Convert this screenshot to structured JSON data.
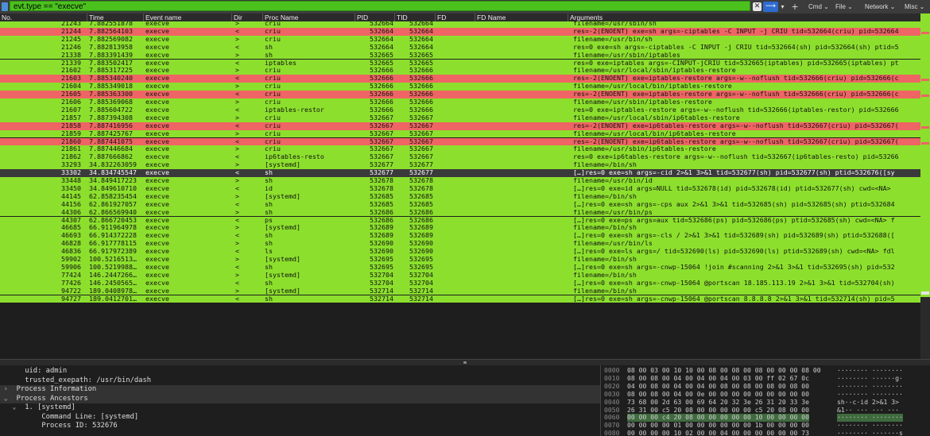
{
  "filter": {
    "value": "evt.type == \"execve\""
  },
  "toolbar": {
    "clear": "✕",
    "apply": "⟶",
    "dropdown": "▾",
    "add": "+"
  },
  "menus": [
    "Cmd ⌄",
    "File ⌄",
    "Network ⌄",
    "Misc ⌄"
  ],
  "columns": [
    "No.",
    "Time",
    "Event name",
    "Dir",
    "Proc Name",
    "PID",
    "TID",
    "FD",
    "FD Name",
    "Arguments"
  ],
  "rows": [
    {
      "no": "21243",
      "time": "7.882551878",
      "ev": "execve",
      "dir": ">",
      "proc": "criu",
      "pid": "532664",
      "tid": "532664",
      "args": "filename=/usr/sbin/sh",
      "c": "green"
    },
    {
      "no": "21244",
      "time": "7.882564103",
      "ev": "execve",
      "dir": "<",
      "proc": "criu",
      "pid": "532664",
      "tid": "532664",
      "args": "res=-2(ENOENT) exe=sh args=-ciptables -C INPUT -j CRIU tid=532664(criu) pid=532664",
      "c": "red"
    },
    {
      "no": "21245",
      "time": "7.882569082",
      "ev": "execve",
      "dir": ">",
      "proc": "criu",
      "pid": "532664",
      "tid": "532664",
      "args": "filename=/usr/bin/sh",
      "c": "green"
    },
    {
      "no": "21246",
      "time": "7.882813958",
      "ev": "execve",
      "dir": "<",
      "proc": "sh",
      "pid": "532664",
      "tid": "532664",
      "args": "res=0 exe=sh args=-ciptables -C INPUT -j CRIU tid=532664(sh) pid=532664(sh) ptid=5",
      "c": "green"
    },
    {
      "no": "21338",
      "time": "7.883391439",
      "ev": "execve",
      "dir": ">",
      "proc": "sh",
      "pid": "532665",
      "tid": "532665",
      "args": "filename=/usr/sbin/iptables",
      "c": "green"
    },
    {
      "no": "21339",
      "time": "7.883502417",
      "ev": "execve",
      "dir": "<",
      "proc": "iptables",
      "pid": "532665",
      "tid": "532665",
      "args": "res=0 exe=iptables args=-CINPUT-jCRIU tid=532665(iptables) pid=532665(iptables) pt",
      "c": "green"
    },
    {
      "no": "21602",
      "time": "7.885317225",
      "ev": "execve",
      "dir": ">",
      "proc": "criu",
      "pid": "532666",
      "tid": "532666",
      "args": "filename=/usr/local/sbin/iptables-restore",
      "c": "green"
    },
    {
      "no": "21603",
      "time": "7.885340240",
      "ev": "execve",
      "dir": "<",
      "proc": "criu",
      "pid": "532666",
      "tid": "532666",
      "args": "res=-2(ENOENT) exe=iptables-restore args=-w--noflush tid=532666(criu) pid=532666(c",
      "c": "red"
    },
    {
      "no": "21604",
      "time": "7.885349018",
      "ev": "execve",
      "dir": ">",
      "proc": "criu",
      "pid": "532666",
      "tid": "532666",
      "args": "filename=/usr/local/bin/iptables-restore",
      "c": "green"
    },
    {
      "no": "21605",
      "time": "7.885363300",
      "ev": "execve",
      "dir": "<",
      "proc": "criu",
      "pid": "532666",
      "tid": "532666",
      "args": "res=-2(ENOENT) exe=iptables-restore args=-w--noflush tid=532666(criu) pid=532666(c",
      "c": "red"
    },
    {
      "no": "21606",
      "time": "7.885369068",
      "ev": "execve",
      "dir": ">",
      "proc": "criu",
      "pid": "532666",
      "tid": "532666",
      "args": "filename=/usr/sbin/iptables-restore",
      "c": "green"
    },
    {
      "no": "21607",
      "time": "7.885604722",
      "ev": "execve",
      "dir": "<",
      "proc": "iptables-restor",
      "pid": "532666",
      "tid": "532666",
      "args": "res=0 exe=iptables-restore args=-w--noflush tid=532666(iptables-restor) pid=532666",
      "c": "green"
    },
    {
      "no": "21857",
      "time": "7.887394308",
      "ev": "execve",
      "dir": ">",
      "proc": "criu",
      "pid": "532667",
      "tid": "532667",
      "args": "filename=/usr/local/sbin/ip6tables-restore",
      "c": "green"
    },
    {
      "no": "21858",
      "time": "7.887416956",
      "ev": "execve",
      "dir": "<",
      "proc": "criu",
      "pid": "532667",
      "tid": "532667",
      "args": "res=-2(ENOENT) exe=ip6tables-restore args=-w--noflush tid=532667(criu) pid=532667(",
      "c": "red"
    },
    {
      "no": "21859",
      "time": "7.887425767",
      "ev": "execve",
      "dir": ">",
      "proc": "criu",
      "pid": "532667",
      "tid": "532667",
      "args": "filename=/usr/local/bin/ip6tables-restore",
      "c": "green"
    },
    {
      "no": "21860",
      "time": "7.887441075",
      "ev": "execve",
      "dir": "<",
      "proc": "criu",
      "pid": "532667",
      "tid": "532667",
      "args": "res=-2(ENOENT) exe=ip6tables-restore args=-w--noflush tid=532667(criu) pid=532667(",
      "c": "red"
    },
    {
      "no": "21861",
      "time": "7.887446684",
      "ev": "execve",
      "dir": ">",
      "proc": "criu",
      "pid": "532667",
      "tid": "532667",
      "args": "filename=/usr/sbin/ip6tables-restore",
      "c": "green"
    },
    {
      "no": "21862",
      "time": "7.887666862",
      "ev": "execve",
      "dir": "<",
      "proc": "ip6tables-resto",
      "pid": "532667",
      "tid": "532667",
      "args": "res=0 exe=ip6tables-restore args=-w--noflush tid=532667(ip6tables-resto) pid=53266",
      "c": "green"
    },
    {
      "no": "33293",
      "time": "34.832263059",
      "ev": "execve",
      "dir": ">",
      "proc": "[systemd]",
      "pid": "532677",
      "tid": "532677",
      "args": "filename=/bin/sh",
      "c": "green"
    },
    {
      "no": "33302",
      "time": "34.834745547",
      "ev": "execve",
      "dir": "<",
      "proc": "sh",
      "pid": "532677",
      "tid": "532677",
      "args": "[…]res=0 exe=sh args=-cid 2>&1 3>&1 tid=532677(sh) pid=532677(sh) ptid=532676([sy",
      "c": "selected"
    },
    {
      "no": "33448",
      "time": "34.849417223",
      "ev": "execve",
      "dir": ">",
      "proc": "sh",
      "pid": "532678",
      "tid": "532678",
      "args": "filename=/usr/bin/id",
      "c": "green"
    },
    {
      "no": "33450",
      "time": "34.849610710",
      "ev": "execve",
      "dir": "<",
      "proc": "id",
      "pid": "532678",
      "tid": "532678",
      "args": "[…]res=0 exe=id args=NULL tid=532678(id) pid=532678(id) ptid=532677(sh) cwd=<NA>",
      "c": "green"
    },
    {
      "no": "44145",
      "time": "62.858235454",
      "ev": "execve",
      "dir": ">",
      "proc": "[systemd]",
      "pid": "532685",
      "tid": "532685",
      "args": "filename=/bin/sh",
      "c": "green"
    },
    {
      "no": "44156",
      "time": "62.861927057",
      "ev": "execve",
      "dir": "<",
      "proc": "sh",
      "pid": "532685",
      "tid": "532685",
      "args": "[…]res=0 exe=sh args=-cps aux 2>&1 3>&1 tid=532685(sh) pid=532685(sh) ptid=532684",
      "c": "green"
    },
    {
      "no": "44306",
      "time": "62.866569940",
      "ev": "execve",
      "dir": ">",
      "proc": "sh",
      "pid": "532686",
      "tid": "532686",
      "args": "filename=/usr/bin/ps",
      "c": "green"
    },
    {
      "no": "44307",
      "time": "62.866720453",
      "ev": "execve",
      "dir": "<",
      "proc": "ps",
      "pid": "532686",
      "tid": "532686",
      "args": "[…]res=0 exe=ps args=aux tid=532686(ps) pid=532686(ps) ptid=532685(sh) cwd=<NA> f",
      "c": "green"
    },
    {
      "no": "46685",
      "time": "66.911964978",
      "ev": "execve",
      "dir": ">",
      "proc": "[systemd]",
      "pid": "532689",
      "tid": "532689",
      "args": "filename=/bin/sh",
      "c": "green"
    },
    {
      "no": "46693",
      "time": "66.914372228",
      "ev": "execve",
      "dir": "<",
      "proc": "sh",
      "pid": "532689",
      "tid": "532689",
      "args": "[…]res=0 exe=sh args=-cls / 2>&1 3>&1 tid=532689(sh) pid=532689(sh) ptid=532688([",
      "c": "green"
    },
    {
      "no": "46828",
      "time": "66.917778115",
      "ev": "execve",
      "dir": ">",
      "proc": "sh",
      "pid": "532690",
      "tid": "532690",
      "args": "filename=/usr/bin/ls",
      "c": "green"
    },
    {
      "no": "46836",
      "time": "66.917972389",
      "ev": "execve",
      "dir": "<",
      "proc": "ls",
      "pid": "532690",
      "tid": "532690",
      "args": "[…]res=0 exe=ls args=/ tid=532690(ls) pid=532690(ls) ptid=532689(sh) cwd=<NA> fdl",
      "c": "green"
    },
    {
      "no": "59902",
      "time": "100.5216513…",
      "ev": "execve",
      "dir": ">",
      "proc": "[systemd]",
      "pid": "532695",
      "tid": "532695",
      "args": "filename=/bin/sh",
      "c": "green"
    },
    {
      "no": "59906",
      "time": "100.5219988…",
      "ev": "execve",
      "dir": "<",
      "proc": "sh",
      "pid": "532695",
      "tid": "532695",
      "args": "[…]res=0 exe=sh args=-cnwp-15064 !join #scanning 2>&1 3>&1 tid=532695(sh) pid=532",
      "c": "green"
    },
    {
      "no": "77424",
      "time": "146.2447266…",
      "ev": "execve",
      "dir": ">",
      "proc": "[systemd]",
      "pid": "532704",
      "tid": "532704",
      "args": "filename=/bin/sh",
      "c": "green"
    },
    {
      "no": "77426",
      "time": "146.2450565…",
      "ev": "execve",
      "dir": "<",
      "proc": "sh",
      "pid": "532704",
      "tid": "532704",
      "args": "[…]res=0 exe=sh args=-cnwp-15064 @portscan 18.185.113.19 2>&1 3>&1 tid=532704(sh)",
      "c": "green"
    },
    {
      "no": "94722",
      "time": "189.0408978…",
      "ev": "execve",
      "dir": ">",
      "proc": "[systemd]",
      "pid": "532714",
      "tid": "532714",
      "args": "filename=/bin/sh",
      "c": "green"
    },
    {
      "no": "94727",
      "time": "189.0412701…",
      "ev": "execve",
      "dir": "<",
      "proc": "sh",
      "pid": "532714",
      "tid": "532714",
      "args": "[…]res=0 exe=sh args=-cnwp-15064 @portscan 8.8.8.8 2>&1 3>&1 tid=532714(sh) pid=5",
      "c": "green"
    }
  ],
  "detail": {
    "lines": [
      {
        "text": "uid: admin",
        "indent": "    ",
        "type": "plain"
      },
      {
        "text": "trusted_exepath: /usr/bin/dash",
        "indent": "    ",
        "type": "plain"
      },
      {
        "text": "Process Information",
        "indent": "  ",
        "twisty": "›",
        "type": "section"
      },
      {
        "text": "Process Ancestors",
        "indent": "  ",
        "twisty": "⌄",
        "type": "section"
      },
      {
        "text": "1. [systemd]",
        "indent": "    ",
        "twisty": "⌄",
        "type": "plain"
      },
      {
        "text": "Command Line: [systemd]",
        "indent": "        ",
        "type": "plain"
      },
      {
        "text": "Process ID: 532676",
        "indent": "        ",
        "type": "plain"
      }
    ]
  },
  "hex": {
    "lines": [
      {
        "off": "0000",
        "bytes": "08 00 03 00 10 10 00 08 00  08 00 08 00 00 00 08 00",
        "ascii": "········ ········"
      },
      {
        "off": "0010",
        "bytes": "08 00 08 00 04 00 04 00  04 00 03 00 ff 02 67 0c",
        "ascii": "········ ······g·"
      },
      {
        "off": "0020",
        "bytes": "04 00 08 00 04 00 04 00  08 00 08 00 08 00 08 00",
        "ascii": "········ ········"
      },
      {
        "off": "0030",
        "bytes": "08 00 08 00 04 00 0e 00  00 00 00 00 00 00 00 00",
        "ascii": "········ ········"
      },
      {
        "off": "0040",
        "bytes": "73 68 00 2d 63 00 69 64  20 32 3e 26 31 20 33 3e",
        "ascii": "sh·-c·id  2>&1 3>"
      },
      {
        "off": "0050",
        "bytes": "26 31 00 c5 20 08 00 00  00 00 00 c5 20 08 00 00",
        "ascii": "&1·· ··· ··· ···"
      },
      {
        "off": "0060",
        "bytes": "00 00 00 c4 20 08 00 00  00 00 00 10 00 00 00 00",
        "ascii": "········ ········"
      },
      {
        "off": "0070",
        "bytes": "00 00 00 00 01 00 00 00  00 00 00 1b 00 00 00 00",
        "ascii": "········ ········"
      },
      {
        "off": "0080",
        "bytes": "00 00 00 00 10 02 00 00  04 00 00 00 00 00 00 73",
        "ascii": "········ ·······s"
      }
    ]
  }
}
